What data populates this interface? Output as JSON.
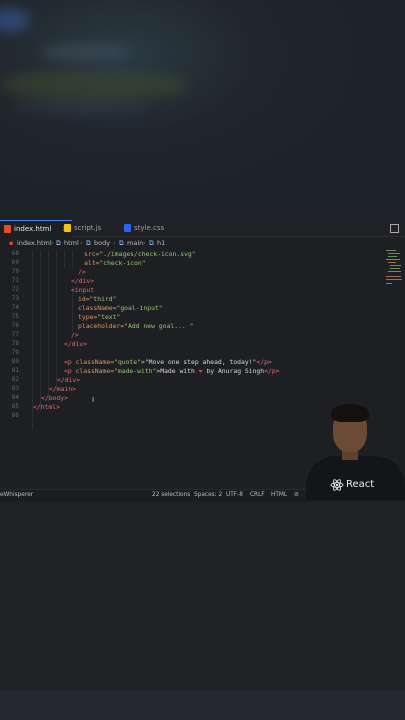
{
  "tabs": [
    {
      "label": "index.html",
      "active": true,
      "close": "✕",
      "icon_color": "#e44d26"
    },
    {
      "label": "script.js",
      "active": false,
      "icon_color": "#f1c40f"
    },
    {
      "label": "style.css",
      "active": false,
      "icon_color": "#2965f1"
    }
  ],
  "breadcrumb": [
    "index.html",
    "html",
    "body",
    "main",
    "h1"
  ],
  "line_numbers": [
    "68",
    "69",
    "70",
    "71",
    "72",
    "73",
    "74",
    "75",
    "76",
    "77",
    "78",
    "79",
    "80",
    "81",
    "82",
    "83",
    "84",
    "85",
    "86"
  ],
  "code": {
    "l68_attr_val": "\"./images/check-icon.svg\"",
    "l68_attr": "src=",
    "l69_attr": "alt=",
    "l69_val": "\"check-icon\"",
    "l70": "/>",
    "l71": "</div>",
    "l72": "<input",
    "l73_attr": "id=",
    "l73_val": "\"third\"",
    "l74_attr": "className=",
    "l74_val": "\"goal-input\"",
    "l75_attr": "type=",
    "l75_val": "\"text\"",
    "l76_attr": "placeholder=",
    "l76_val": "\"Add new goal... \"",
    "l77": "/>",
    "l78": "</div>",
    "l80_open": "<p",
    "l80_attr": "className=",
    "l80_val": "\"quote\"",
    "l80_text": ">\"Move one step ahead, today!\"",
    "l80_close": "</p>",
    "l81_open": "<p",
    "l81_attr": "className=",
    "l81_val": "\"made-with\"",
    "l81_text_a": ">Made with ",
    "l81_heart": "❤",
    "l81_text_b": " by Anurag Singh",
    "l81_close": "</p>",
    "l82": "</div>",
    "l83": "</main>",
    "l84": "</body>",
    "l85": "</html>"
  },
  "status": {
    "left": "eWhisperer",
    "selections": "22 selections",
    "spaces": "Spaces: 2",
    "encoding": "UTF-8",
    "eol": "CRLF",
    "language": "HTML"
  },
  "presenter": {
    "shirt_text": "React"
  },
  "colors": {
    "accent": "#3b82f6",
    "react": "#61dafb"
  }
}
